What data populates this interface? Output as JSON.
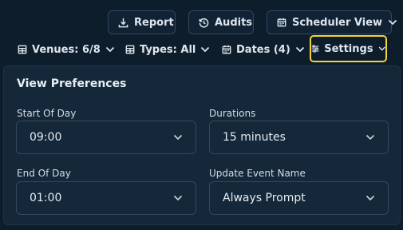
{
  "toolbar": {
    "report_label": "Report",
    "audits_label": "Audits",
    "scheduler_view_label": "Scheduler View"
  },
  "filters": {
    "venues_label": "Venues: 6/8",
    "types_label": "Types: All",
    "dates_label": "Dates (4)",
    "settings_label": "Settings"
  },
  "panel": {
    "title": "View Preferences",
    "start_of_day": {
      "label": "Start Of Day",
      "value": "09:00"
    },
    "durations": {
      "label": "Durations",
      "value": "15 minutes"
    },
    "end_of_day": {
      "label": "End Of Day",
      "value": "01:00"
    },
    "update_event_name": {
      "label": "Update Event Name",
      "value": "Always Prompt"
    }
  },
  "colors": {
    "background": "#0e1d2b",
    "panel": "#14283a",
    "highlight": "#f1d33b"
  },
  "icons": [
    "download-icon",
    "history-icon",
    "calendar-icon",
    "chevron-down-icon",
    "table-icon",
    "sliders-icon"
  ]
}
